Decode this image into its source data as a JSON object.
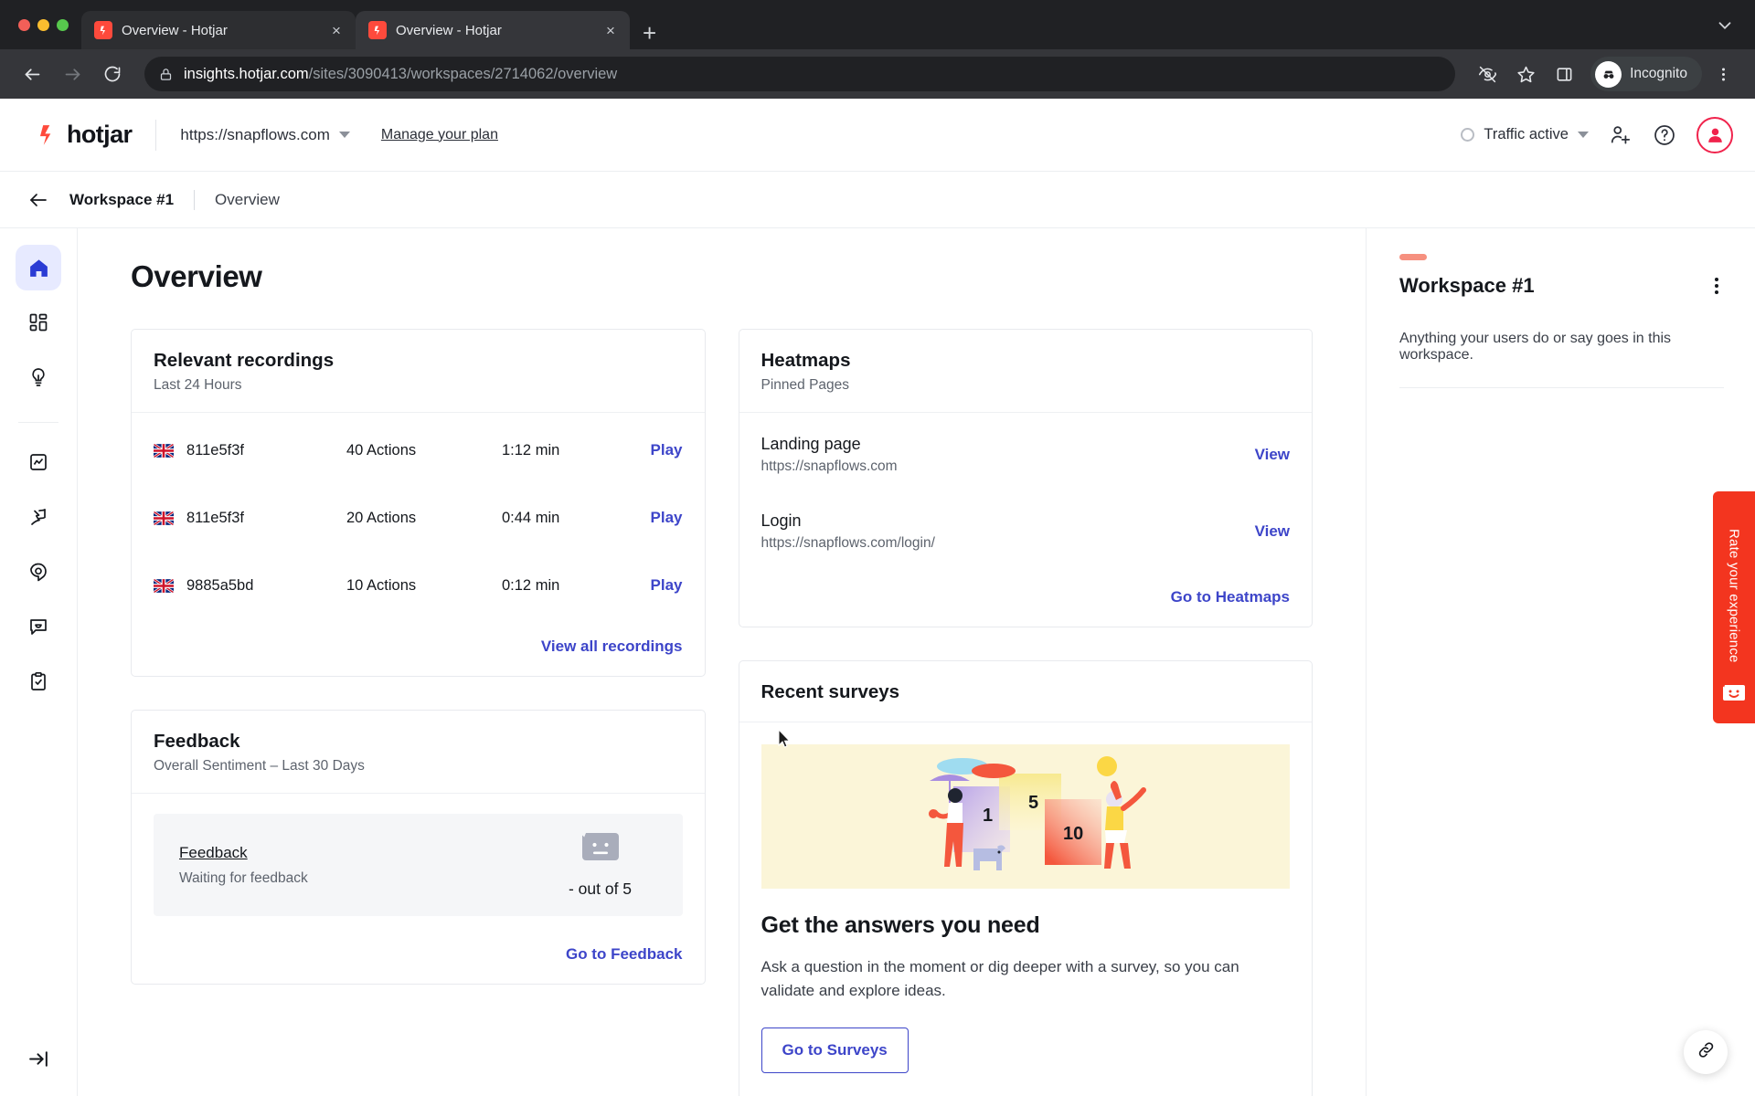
{
  "browser": {
    "tabs": [
      {
        "title": "Overview - Hotjar",
        "close": "×",
        "favicon": "hotjar-favicon"
      },
      {
        "title": "Overview - Hotjar",
        "close": "×",
        "favicon": "hotjar-favicon"
      }
    ],
    "new_tab_label": "+",
    "tabstrip_chevron": "chevron-down-icon",
    "url_secure": "insights.hotjar.com",
    "url_path": "/sites/3090413/workspaces/2714062/overview",
    "profile_label": "Incognito",
    "toolbar_icons": [
      "back-arrow",
      "forward-arrow",
      "reload",
      "lock",
      "eye-off",
      "star",
      "side-panel",
      "incognito",
      "kebab-menu"
    ]
  },
  "app_header": {
    "logo_text": "hotjar",
    "site": "https://snapflows.com",
    "manage_plan": "Manage your plan",
    "traffic_status": "Traffic active",
    "icons": {
      "add_user": "add-user-icon",
      "help": "help-circle-icon",
      "avatar": "user-avatar-icon"
    }
  },
  "breadcrumb": {
    "workspace": "Workspace #1",
    "current": "Overview",
    "back": "back-arrow-icon"
  },
  "sidebar": {
    "items": [
      {
        "name": "home",
        "icon": "home-icon",
        "active": true
      },
      {
        "name": "dashboards",
        "icon": "grid-icon",
        "active": false
      },
      {
        "name": "insights",
        "icon": "lightbulb-icon",
        "active": false
      },
      {
        "name": "trends",
        "icon": "chart-square-icon",
        "active": false
      },
      {
        "name": "recordings",
        "icon": "cursor-flag-icon",
        "active": false
      },
      {
        "name": "heatmaps",
        "icon": "location-pin-icon",
        "active": false
      },
      {
        "name": "feedback",
        "icon": "chat-bubble-icon",
        "active": false
      },
      {
        "name": "surveys",
        "icon": "clipboard-check-icon",
        "active": false
      }
    ],
    "collapse_icon": "collapse-panel-icon"
  },
  "main": {
    "page_title": "Overview",
    "recordings_card": {
      "title": "Relevant recordings",
      "subtitle": "Last 24 Hours",
      "rows": [
        {
          "flag": "uk-flag",
          "id": "811e5f3f",
          "actions": "40 Actions",
          "duration": "1:12 min",
          "action": "Play"
        },
        {
          "flag": "uk-flag",
          "id": "811e5f3f",
          "actions": "20 Actions",
          "duration": "0:44 min",
          "action": "Play"
        },
        {
          "flag": "uk-flag",
          "id": "9885a5bd",
          "actions": "10 Actions",
          "duration": "0:12 min",
          "action": "Play"
        }
      ],
      "footer_link": "View all recordings"
    },
    "feedback_card": {
      "title": "Feedback",
      "subtitle": "Overall Sentiment – Last 30 Days",
      "panel_label": "Feedback",
      "panel_status": "Waiting for feedback",
      "score": "- out of 5",
      "face_icon": "neutral-face-icon",
      "footer_link": "Go to Feedback"
    },
    "heatmaps_card": {
      "title": "Heatmaps",
      "subtitle": "Pinned Pages",
      "rows": [
        {
          "name": "Landing page",
          "url": "https://snapflows.com",
          "action": "View"
        },
        {
          "name": "Login",
          "url": "https://snapflows.com/login/",
          "action": "View"
        }
      ],
      "footer_link": "Go to Heatmaps"
    },
    "surveys_card": {
      "title": "Recent surveys",
      "hero_icon": "surveys-illustration",
      "hero_numbers": [
        "1",
        "5",
        "10"
      ],
      "heading": "Get the answers you need",
      "body": "Ask a question in the moment or dig deeper with a survey, so you can validate and explore ideas.",
      "button": "Go to Surveys"
    }
  },
  "right_panel": {
    "accent_color": "#f6907f",
    "title": "Workspace #1",
    "description": "Anything your users do or say goes in this workspace.",
    "menu_icon": "kebab-menu-icon"
  },
  "rate_tab": {
    "label": "Rate your experience",
    "color": "#f3351f",
    "icon": "smiley-feedback-icon"
  },
  "float_button": {
    "icon": "link-icon"
  }
}
